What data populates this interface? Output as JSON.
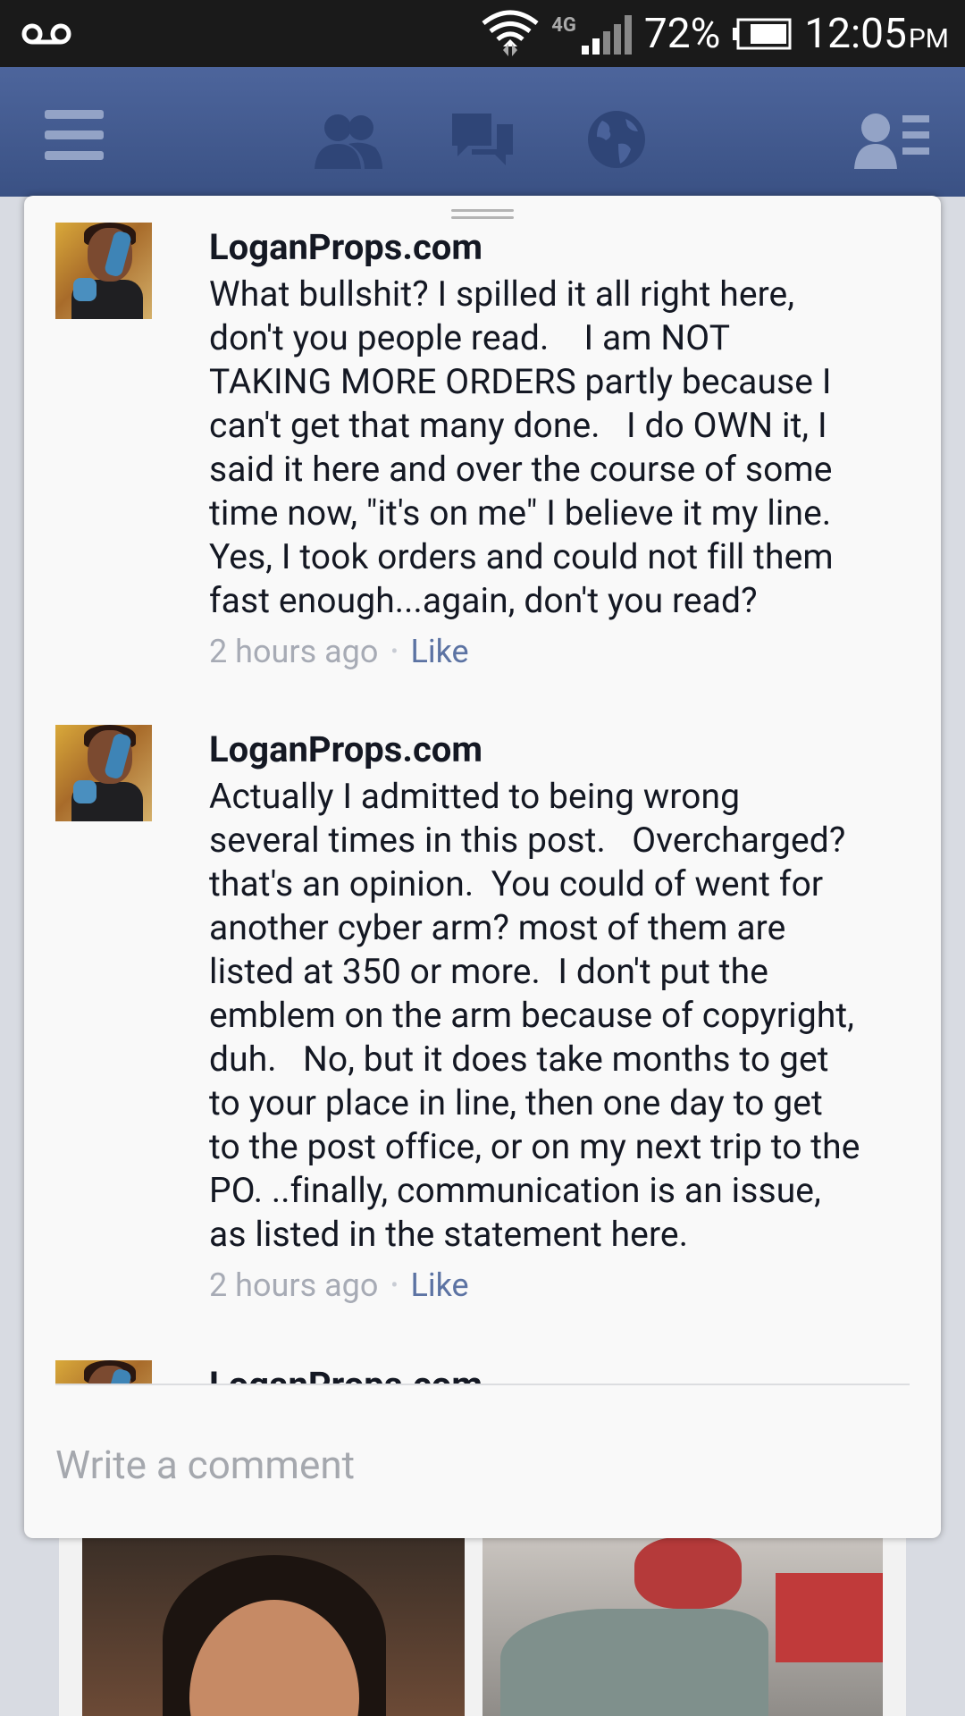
{
  "status_bar": {
    "network": "4G",
    "battery": "72%",
    "time": "12:05",
    "ampm": "PM"
  },
  "nav": {
    "items": [
      "menu-icon",
      "friend-requests-icon",
      "messages-icon",
      "notifications-globe-icon",
      "friends-list-icon"
    ]
  },
  "comments": [
    {
      "author": "LoganProps.com",
      "text": "What bullshit? I spilled it all right here,\ndon't you people read.    I am NOT\nTAKING MORE ORDERS partly because I\ncan't get that many done.   I do OWN it, I\nsaid it here and over the course of some\ntime now, \"it's on me\" I believe it my line.\nYes, I took orders and could not fill them\nfast enough...again, don't you read?",
      "time": "2 hours ago",
      "like_label": "Like"
    },
    {
      "author": "LoganProps.com",
      "text": "Actually I admitted to being wrong\nseveral times in this post.   Overcharged?\nthat's an opinion.  You could of went for\nanother cyber arm? most of them are\nlisted at 350 or more.  I don't put the\nemblem on the arm because of copyright,\nduh.   No, but it does take months to get\nto your place in line, then one day to get\nto the post office, or on my next trip to the\nPO. ..finally, communication is an issue,\nas listed in the statement here.",
      "time": "2 hours ago",
      "like_label": "Like"
    },
    {
      "author": "LoganProps.com"
    }
  ],
  "composer": {
    "placeholder": "Write a comment"
  }
}
